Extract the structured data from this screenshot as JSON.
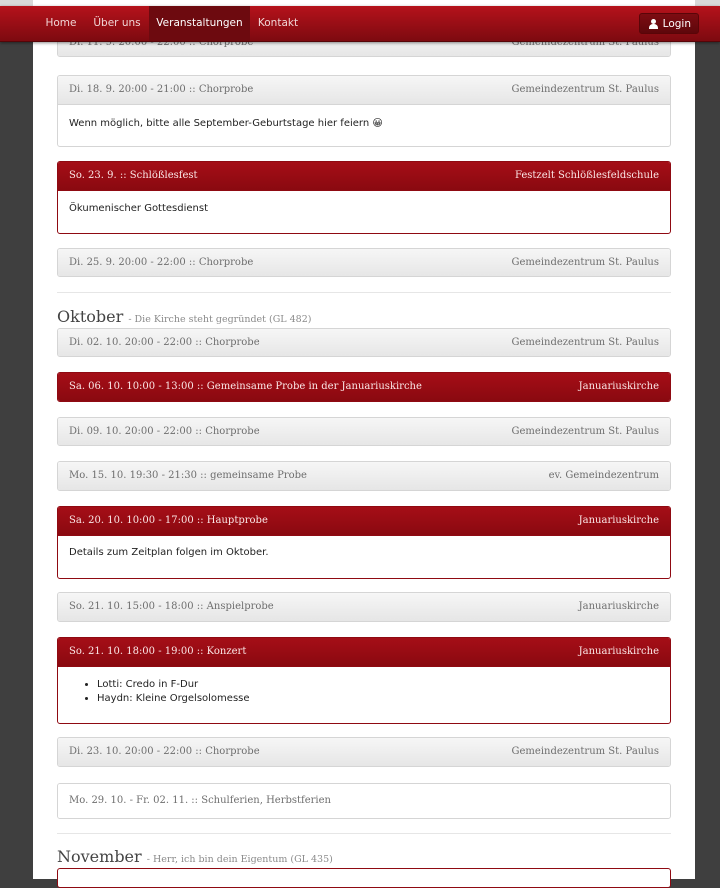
{
  "nav": {
    "items": [
      "Home",
      "Über uns",
      "Veranstaltungen",
      "Kontakt"
    ],
    "active": "Veranstaltungen",
    "login_label": "Login"
  },
  "colors": {
    "brand": "#a50e17",
    "brand_dark": "#7d0a10"
  },
  "events_sep": [
    {
      "title": "Di. 11. 9. 20:00 - 22:00 :: Chorprobe",
      "location": "Gemeindezentrum St. Paulus"
    },
    {
      "title": "Di. 18. 9. 20:00 - 21:00 :: Chorprobe",
      "location": "Gemeindezentrum St. Paulus",
      "body": "Wenn möglich, bitte alle September-Geburtstage hier feiern 😀"
    },
    {
      "title": "So. 23. 9. :: Schlößlesfest",
      "location": "Festzelt Schlößlesfeldschule",
      "highlight": true,
      "body": "Ökumenischer Gottesdienst"
    },
    {
      "title": "Di. 25. 9. 20:00 - 22:00 :: Chorprobe",
      "location": "Gemeindezentrum St. Paulus"
    }
  ],
  "october": {
    "name": "Oktober",
    "subtitle": "- Die Kirche steht gegründet (GL 482)",
    "events": [
      {
        "title": "Di. 02. 10. 20:00 - 22:00 :: Chorprobe",
        "location": "Gemeindezentrum St. Paulus"
      },
      {
        "title": "Sa. 06. 10. 10:00 - 13:00 :: Gemeinsame Probe in der Januariuskirche",
        "location": "Januariuskirche",
        "highlight": true
      },
      {
        "title": "Di. 09. 10. 20:00 - 22:00 :: Chorprobe",
        "location": "Gemeindezentrum St. Paulus"
      },
      {
        "title": "Mo. 15. 10. 19:30 - 21:30 :: gemeinsame Probe",
        "location": "ev. Gemeindezentrum"
      },
      {
        "title": "Sa. 20. 10. 10:00 - 17:00 :: Hauptprobe",
        "location": "Januariuskirche",
        "highlight": true,
        "body": "Details zum Zeitplan folgen im Oktober."
      },
      {
        "title": "So. 21. 10. 15:00 - 18:00 :: Anspielprobe",
        "location": "Januariuskirche"
      },
      {
        "title": "So. 21. 10. 18:00 - 19:00 :: Konzert",
        "location": "Januariuskirche",
        "highlight": true,
        "list": [
          "Lotti: Credo in F-Dur",
          "Haydn: Kleine Orgelsolomesse"
        ]
      },
      {
        "title": "Di. 23. 10. 20:00 - 22:00 :: Chorprobe",
        "location": "Gemeindezentrum St. Paulus"
      },
      {
        "title": "Mo. 29. 10. - Fr. 02. 11. :: Schulferien, Herbstferien",
        "location": ""
      }
    ]
  },
  "november": {
    "name": "November",
    "subtitle": "- Herr, ich bin dein Eigentum (GL 435)"
  }
}
